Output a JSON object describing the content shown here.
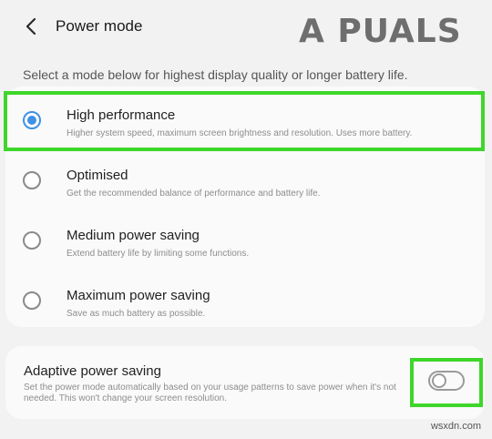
{
  "header": {
    "back_icon": "chevron-left-icon",
    "title": "Power mode"
  },
  "logo": {
    "text": "A PUALS"
  },
  "description": "Select a mode below for highest display quality or longer battery life.",
  "options": [
    {
      "label": "High performance",
      "sub": "Higher system speed, maximum screen brightness and resolution. Uses more battery.",
      "selected": true
    },
    {
      "label": "Optimised",
      "sub": "Get the recommended balance of performance and battery life.",
      "selected": false
    },
    {
      "label": "Medium power saving",
      "sub": "Extend battery life by limiting some functions.",
      "selected": false
    },
    {
      "label": "Maximum power saving",
      "sub": "Save as much battery as possible.",
      "selected": false
    }
  ],
  "adaptive": {
    "title": "Adaptive power saving",
    "description": "Set the power mode automatically based on your usage patterns to save power when it's not needed. This won't change your screen resolution.",
    "toggle_on": false
  },
  "colors": {
    "accent": "#3e91e4",
    "highlight": "#3ed62a",
    "background": "#f2f2f2"
  },
  "watermark": "wsxdn.com"
}
